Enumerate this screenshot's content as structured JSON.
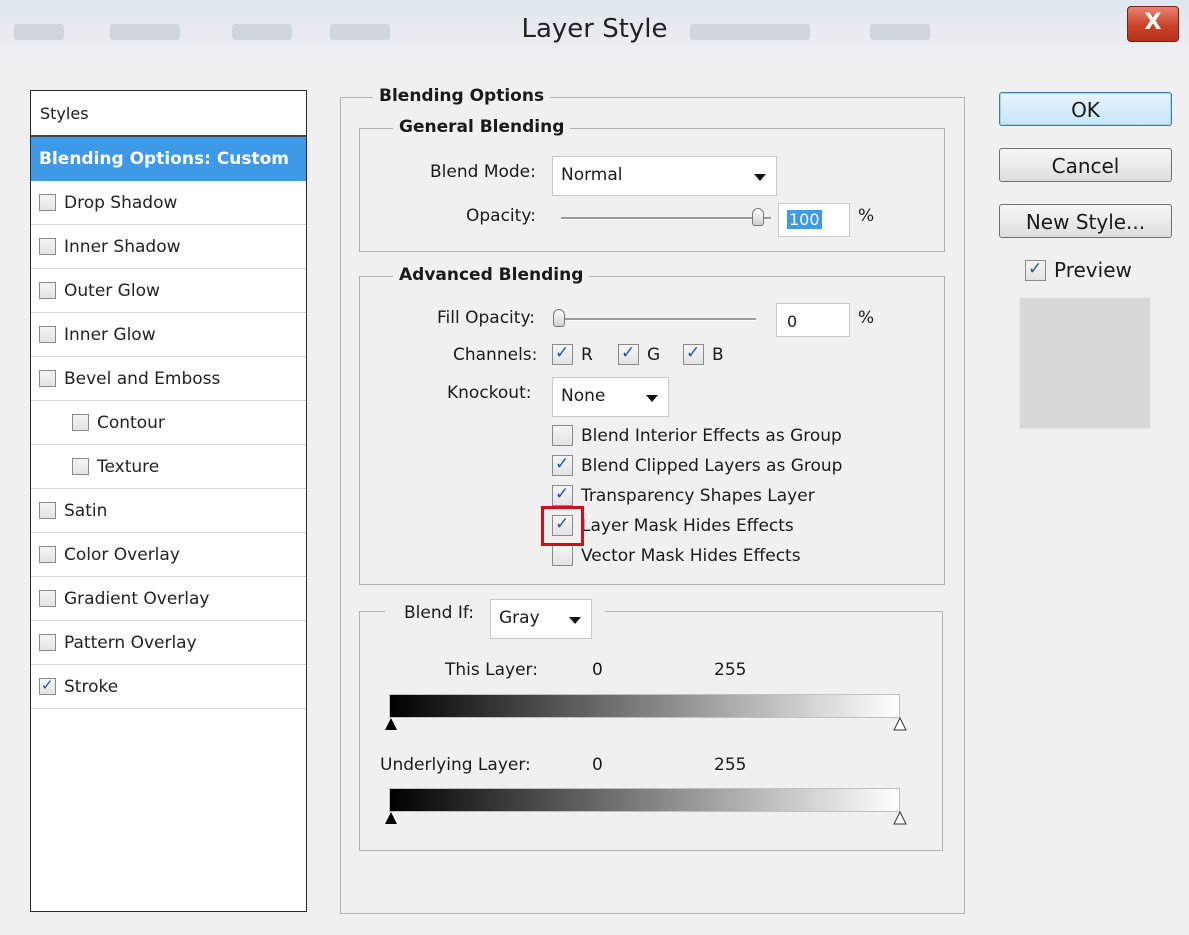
{
  "window": {
    "title": "Layer Style",
    "close_label": "X"
  },
  "styles_panel": {
    "header": "Styles",
    "items": [
      {
        "label": "Blending Options: Custom",
        "selected": true
      },
      {
        "label": "Drop Shadow",
        "checked": false
      },
      {
        "label": "Inner Shadow",
        "checked": false
      },
      {
        "label": "Outer Glow",
        "checked": false
      },
      {
        "label": "Inner Glow",
        "checked": false
      },
      {
        "label": "Bevel and Emboss",
        "checked": false
      },
      {
        "label": "Contour",
        "checked": false,
        "sub": true
      },
      {
        "label": "Texture",
        "checked": false,
        "sub": true
      },
      {
        "label": "Satin",
        "checked": false
      },
      {
        "label": "Color Overlay",
        "checked": false
      },
      {
        "label": "Gradient Overlay",
        "checked": false
      },
      {
        "label": "Pattern Overlay",
        "checked": false
      },
      {
        "label": "Stroke",
        "checked": true
      }
    ]
  },
  "blending_options": {
    "title": "Blending Options",
    "general": {
      "title": "General Blending",
      "blend_mode_label": "Blend Mode:",
      "blend_mode_value": "Normal",
      "opacity_label": "Opacity:",
      "opacity_value": "100",
      "opacity_unit": "%"
    },
    "advanced": {
      "title": "Advanced Blending",
      "fill_opacity_label": "Fill Opacity:",
      "fill_opacity_value": "0",
      "fill_opacity_unit": "%",
      "channels_label": "Channels:",
      "channels": [
        {
          "label": "R",
          "checked": true
        },
        {
          "label": "G",
          "checked": true
        },
        {
          "label": "B",
          "checked": true
        }
      ],
      "knockout_label": "Knockout:",
      "knockout_value": "None",
      "options": [
        {
          "label": "Blend Interior Effects as Group",
          "checked": false
        },
        {
          "label": "Blend Clipped Layers as Group",
          "checked": true
        },
        {
          "label": "Transparency Shapes Layer",
          "checked": true
        },
        {
          "label": "Layer Mask Hides Effects",
          "checked": true,
          "highlighted": true
        },
        {
          "label": "Vector Mask Hides Effects",
          "checked": false
        }
      ]
    },
    "blend_if": {
      "label": "Blend If:",
      "value": "Gray",
      "this_layer_label": "This Layer:",
      "this_layer_min": "0",
      "this_layer_max": "255",
      "underlying_label": "Underlying Layer:",
      "underlying_min": "0",
      "underlying_max": "255"
    }
  },
  "buttons": {
    "ok": "OK",
    "cancel": "Cancel",
    "new_style": "New Style...",
    "preview_label": "Preview",
    "preview_checked": true
  },
  "colors": {
    "selection": "#3e99e7",
    "highlight": "#d0101a",
    "checkmark": "#2d4f9e"
  }
}
